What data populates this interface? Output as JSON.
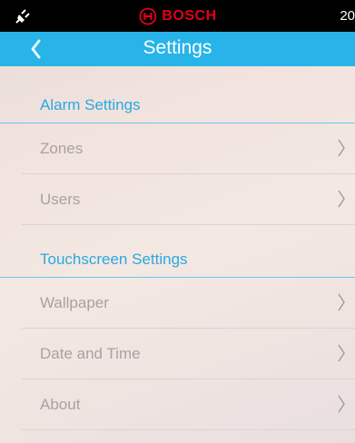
{
  "status_bar": {
    "brand": "BOSCH",
    "clock": "20"
  },
  "header": {
    "title": "Settings"
  },
  "sections": [
    {
      "title": "Alarm Settings",
      "items": [
        "Zones",
        "Users"
      ]
    },
    {
      "title": "Touchscreen Settings",
      "items": [
        "Wallpaper",
        "Date and Time",
        "About"
      ]
    }
  ],
  "colors": {
    "accent": "#28b4e8",
    "brand_red": "#e2001a",
    "item_text": "#a8a2a0"
  }
}
